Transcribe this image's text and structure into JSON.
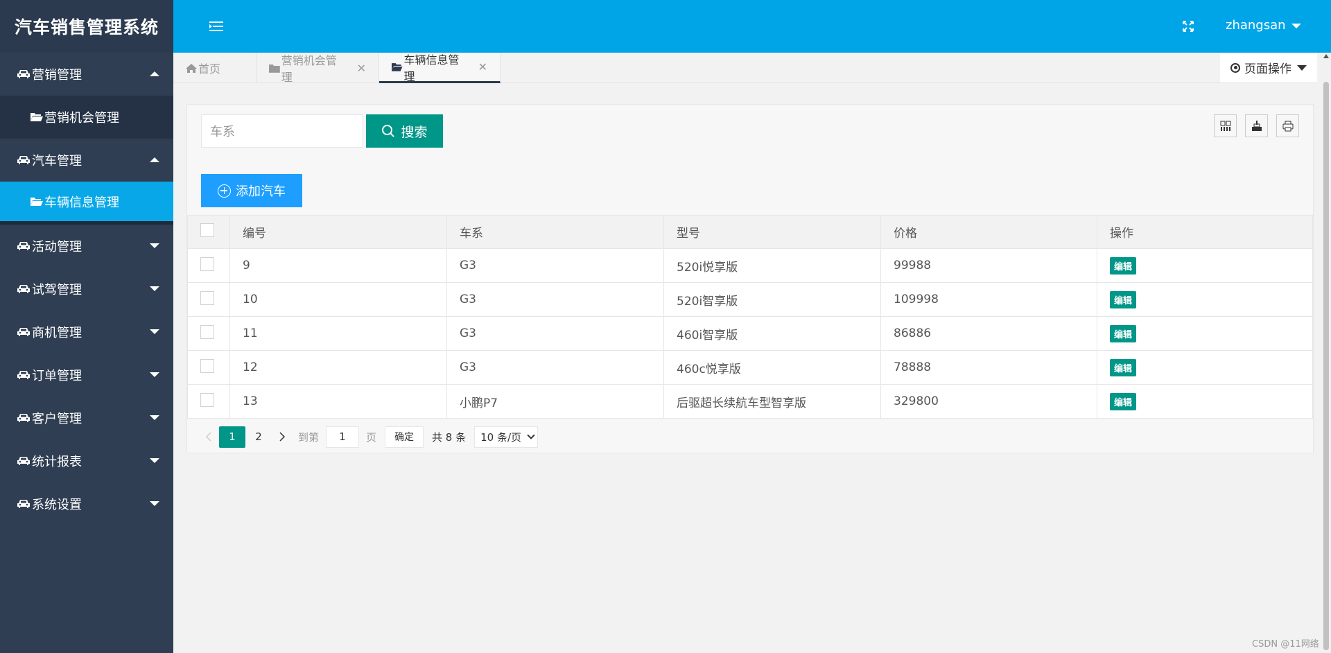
{
  "app": {
    "title": "汽车销售管理系统"
  },
  "header": {
    "username": "zhangsan"
  },
  "sidebar": {
    "groups": [
      {
        "label": "营销管理",
        "expanded": true,
        "children": [
          {
            "label": "营销机会管理",
            "active": false
          }
        ]
      },
      {
        "label": "汽车管理",
        "expanded": true,
        "children": [
          {
            "label": "车辆信息管理",
            "active": true
          }
        ]
      },
      {
        "label": "活动管理",
        "expanded": false
      },
      {
        "label": "试驾管理",
        "expanded": false
      },
      {
        "label": "商机管理",
        "expanded": false
      },
      {
        "label": "订单管理",
        "expanded": false
      },
      {
        "label": "客户管理",
        "expanded": false
      },
      {
        "label": "统计报表",
        "expanded": false
      },
      {
        "label": "系统设置",
        "expanded": false
      }
    ]
  },
  "tabs": [
    {
      "label": "首页",
      "icon": "home-icon",
      "closable": false
    },
    {
      "label": "营销机会管理",
      "icon": "folder-icon",
      "closable": true
    },
    {
      "label": "车辆信息管理",
      "icon": "folder-open-icon",
      "closable": true,
      "active": true
    }
  ],
  "tab_close": "✕",
  "page_ops": {
    "label": "页面操作"
  },
  "search": {
    "placeholder": "车系",
    "button_label": "搜索"
  },
  "toolbar": {
    "add_label": "添加汽车",
    "icons": [
      "columns-icon",
      "export-icon",
      "print-icon"
    ]
  },
  "table": {
    "columns": [
      "编号",
      "车系",
      "型号",
      "价格",
      "操作"
    ],
    "rows": [
      {
        "id": "9",
        "series": "G3",
        "model": "520i悦享版",
        "price": "99988",
        "action": "编辑"
      },
      {
        "id": "10",
        "series": "G3",
        "model": "520i智享版",
        "price": "109998",
        "action": "编辑"
      },
      {
        "id": "11",
        "series": "G3",
        "model": "460i智享版",
        "price": "86886",
        "action": "编辑"
      },
      {
        "id": "12",
        "series": "G3",
        "model": "460c悦享版",
        "price": "78888",
        "action": "编辑"
      },
      {
        "id": "13",
        "series": "小鹏P7",
        "model": "后驱超长续航车型智享版",
        "price": "329800",
        "action": "编辑"
      }
    ]
  },
  "pager": {
    "pages": [
      "1",
      "2"
    ],
    "current": "1",
    "goto_label": "到第",
    "goto_value": "1",
    "page_unit": "页",
    "confirm": "确定",
    "total": "共 8 条",
    "page_size": "10 条/页"
  },
  "watermark": "CSDN @11网络",
  "colors": {
    "header": "#00a5e8",
    "sidebar": "#2f3e52",
    "primary": "#009688",
    "add_button": "#1e9fff"
  }
}
